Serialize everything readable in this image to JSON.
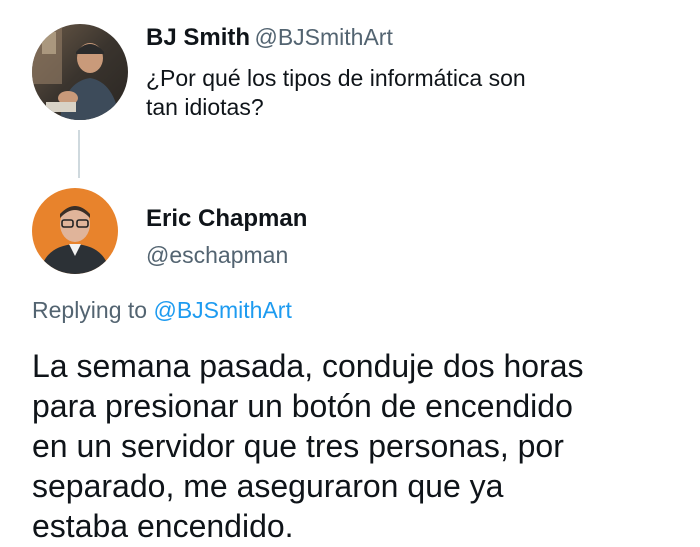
{
  "original_tweet": {
    "display_name": "BJ Smith",
    "handle": "@BJSmithArt",
    "text_lines": [
      "¿Por qué los tipos de informática son",
      "tan idiotas?"
    ]
  },
  "reply_tweet": {
    "display_name": "Eric Chapman",
    "handle": "@eschapman",
    "replying_to_prefix": "Replying to",
    "replying_to_handle": "@BJSmithArt",
    "text_lines": [
      "La semana pasada, conduje dos horas",
      "para presionar un botón de encendido",
      "en un servidor que tres personas, por",
      "separado, me aseguraron que ya",
      "estaba encendido."
    ]
  },
  "colors": {
    "text_primary": "#0f1419",
    "text_secondary": "#536471",
    "accent": "#1d9bf0",
    "thread_line": "#cfd9de",
    "avatar_eric_bg": "#e8832c"
  },
  "icons": {
    "avatar_bj": "person-photo-avatar",
    "avatar_eric": "person-photo-avatar"
  }
}
